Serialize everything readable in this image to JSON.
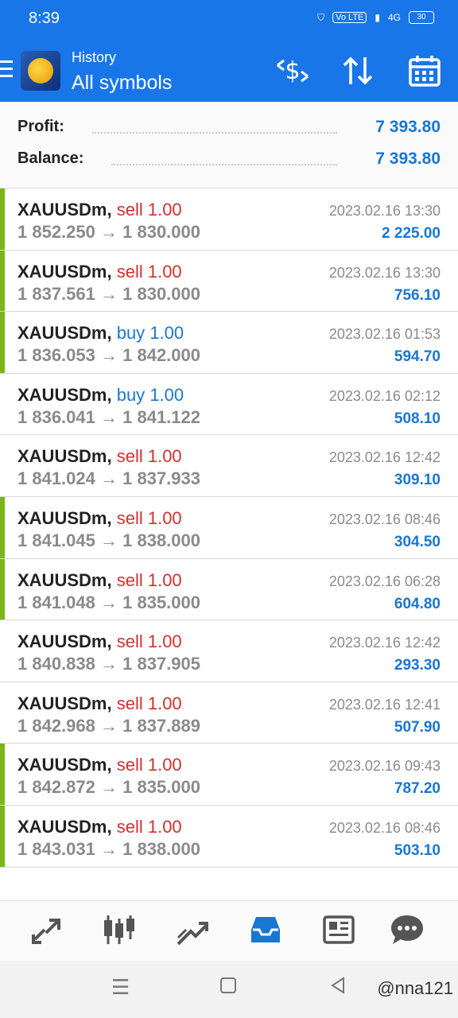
{
  "status": {
    "time": "8:39",
    "battery": "30",
    "network": "4G",
    "volte": "Vo LTE"
  },
  "header": {
    "subtitle": "History",
    "title": "All symbols"
  },
  "summary": {
    "profit_label": "Profit:",
    "profit_value": "7 393.80",
    "balance_label": "Balance:",
    "balance_value": "7 393.80"
  },
  "trades": [
    {
      "symbol": "XAUUSDm,",
      "direction": "sell",
      "volume": "1.00",
      "open": "1 852.250",
      "close": "1 830.000",
      "time": "2023.02.16 13:30",
      "profit": "2 225.00",
      "bar": true
    },
    {
      "symbol": "XAUUSDm,",
      "direction": "sell",
      "volume": "1.00",
      "open": "1 837.561",
      "close": "1 830.000",
      "time": "2023.02.16 13:30",
      "profit": "756.10",
      "bar": true
    },
    {
      "symbol": "XAUUSDm,",
      "direction": "buy",
      "volume": "1.00",
      "open": "1 836.053",
      "close": "1 842.000",
      "time": "2023.02.16 01:53",
      "profit": "594.70",
      "bar": true
    },
    {
      "symbol": "XAUUSDm,",
      "direction": "buy",
      "volume": "1.00",
      "open": "1 836.041",
      "close": "1 841.122",
      "time": "2023.02.16 02:12",
      "profit": "508.10",
      "bar": false
    },
    {
      "symbol": "XAUUSDm,",
      "direction": "sell",
      "volume": "1.00",
      "open": "1 841.024",
      "close": "1 837.933",
      "time": "2023.02.16 12:42",
      "profit": "309.10",
      "bar": false
    },
    {
      "symbol": "XAUUSDm,",
      "direction": "sell",
      "volume": "1.00",
      "open": "1 841.045",
      "close": "1 838.000",
      "time": "2023.02.16 08:46",
      "profit": "304.50",
      "bar": true
    },
    {
      "symbol": "XAUUSDm,",
      "direction": "sell",
      "volume": "1.00",
      "open": "1 841.048",
      "close": "1 835.000",
      "time": "2023.02.16 06:28",
      "profit": "604.80",
      "bar": true
    },
    {
      "symbol": "XAUUSDm,",
      "direction": "sell",
      "volume": "1.00",
      "open": "1 840.838",
      "close": "1 837.905",
      "time": "2023.02.16 12:42",
      "profit": "293.30",
      "bar": false
    },
    {
      "symbol": "XAUUSDm,",
      "direction": "sell",
      "volume": "1.00",
      "open": "1 842.968",
      "close": "1 837.889",
      "time": "2023.02.16 12:41",
      "profit": "507.90",
      "bar": false
    },
    {
      "symbol": "XAUUSDm,",
      "direction": "sell",
      "volume": "1.00",
      "open": "1 842.872",
      "close": "1 835.000",
      "time": "2023.02.16 09:43",
      "profit": "787.20",
      "bar": true
    },
    {
      "symbol": "XAUUSDm,",
      "direction": "sell",
      "volume": "1.00",
      "open": "1 843.031",
      "close": "1 838.000",
      "time": "2023.02.16 08:46",
      "profit": "503.10",
      "bar": true
    }
  ],
  "arrow": "→",
  "nav": [
    {
      "name": "quotes-icon",
      "glyph": "⇗"
    },
    {
      "name": "chart-candles-icon",
      "glyph": "▥"
    },
    {
      "name": "trade-icon",
      "glyph": "↗"
    },
    {
      "name": "history-inbox-icon",
      "glyph": "▭"
    },
    {
      "name": "news-icon",
      "glyph": "▤"
    },
    {
      "name": "chat-icon",
      "glyph": "●"
    }
  ],
  "watermark": "@nna121",
  "colors": {
    "primary": "#1976e8",
    "sell": "#d32f2f",
    "buy": "#1976d2",
    "profit": "#1976d2",
    "bar": "#7cb518"
  }
}
